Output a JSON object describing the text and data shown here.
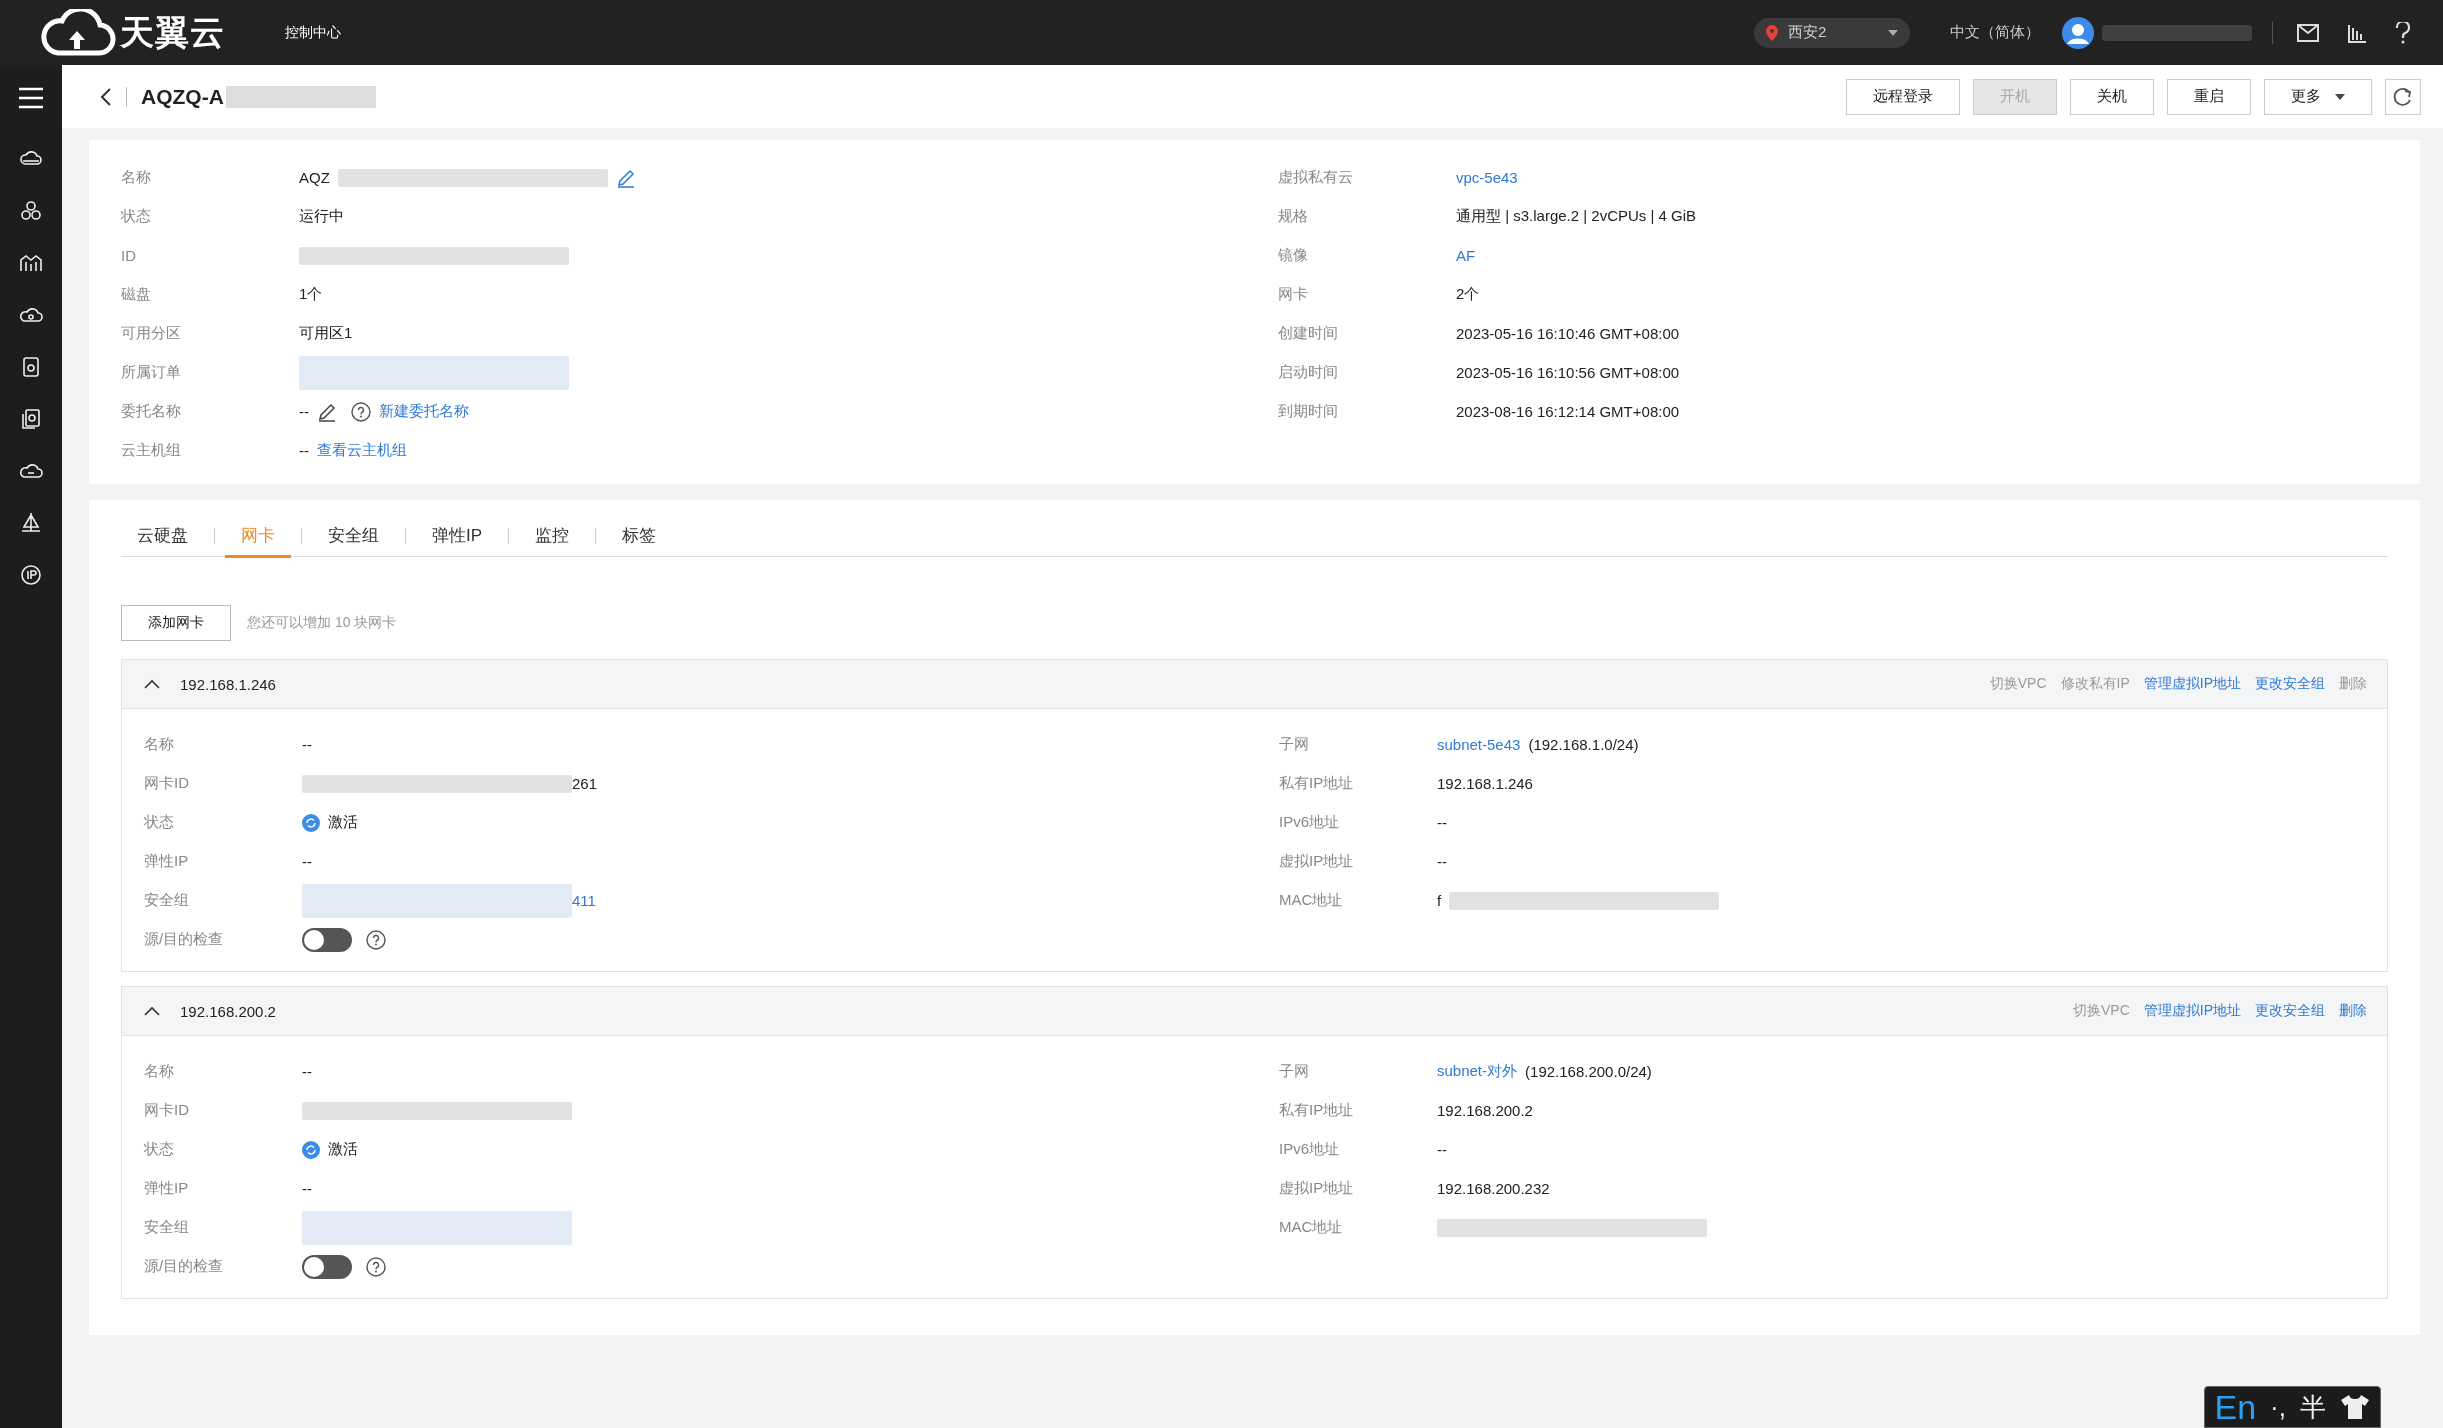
{
  "topbar": {
    "logo": "天翼云",
    "console": "控制中心",
    "region": "西安2",
    "language": "中文（简体）"
  },
  "header": {
    "title": "AQZQ-A",
    "buttons": [
      {
        "label": "远程登录",
        "disabled": false
      },
      {
        "label": "开机",
        "disabled": true
      },
      {
        "label": "关机",
        "disabled": false
      },
      {
        "label": "重启",
        "disabled": false
      },
      {
        "label": "更多",
        "disabled": false,
        "kind": "dropdown"
      }
    ]
  },
  "details": {
    "left": [
      {
        "label": "名称",
        "kind": "editable",
        "value": "AQZ"
      },
      {
        "label": "状态",
        "kind": "text",
        "value": "运行中"
      },
      {
        "label": "ID",
        "kind": "redacted"
      },
      {
        "label": "磁盘",
        "kind": "text",
        "value": "1个"
      },
      {
        "label": "可用分区",
        "kind": "text",
        "value": "可用区1"
      },
      {
        "label": "所属订单",
        "kind": "redacted",
        "is_link": true
      },
      {
        "label": "委托名称",
        "kind": "delegate",
        "value": "--",
        "link": "新建委托名称"
      },
      {
        "label": "云主机组",
        "kind": "value-link",
        "value": "--",
        "link": "查看云主机组"
      }
    ],
    "right": [
      {
        "label": "虚拟私有云",
        "kind": "link",
        "value": "vpc-5e43"
      },
      {
        "label": "规格",
        "kind": "text",
        "value": "通用型 | s3.large.2 | 2vCPUs | 4 GiB"
      },
      {
        "label": "镜像",
        "kind": "link",
        "value": "AF"
      },
      {
        "label": "网卡",
        "kind": "text",
        "value": "2个"
      },
      {
        "label": "创建时间",
        "kind": "text",
        "value": "2023-05-16 16:10:46 GMT+08:00"
      },
      {
        "label": "启动时间",
        "kind": "text",
        "value": "2023-05-16 16:10:56 GMT+08:00"
      },
      {
        "label": "到期时间",
        "kind": "text",
        "value": "2023-08-16 16:12:14 GMT+08:00"
      }
    ]
  },
  "tabs": [
    {
      "label": "云硬盘",
      "selected": false
    },
    {
      "label": "网卡",
      "selected": true
    },
    {
      "label": "安全组",
      "selected": false
    },
    {
      "label": "弹性IP",
      "selected": false
    },
    {
      "label": "监控",
      "selected": false
    },
    {
      "label": "标签",
      "selected": false
    }
  ],
  "add_button": "添加网卡",
  "add_hint": "您还可以增加 10 块网卡",
  "nics": [
    {
      "ip": "192.168.1.246",
      "expanded": true,
      "actions": [
        {
          "label": "切换VPC",
          "disabled": true
        },
        {
          "label": "修改私有IP",
          "disabled": true
        },
        {
          "label": "管理虚拟IP地址",
          "disabled": false
        },
        {
          "label": "更改安全组",
          "disabled": false
        },
        {
          "label": "删除",
          "disabled": true
        }
      ],
      "left": [
        {
          "label": "名称",
          "kind": "text",
          "value": "--"
        },
        {
          "label": "网卡ID",
          "kind": "redacted",
          "suffix": "261"
        },
        {
          "label": "状态",
          "kind": "status",
          "value": "激活"
        },
        {
          "label": "弹性IP",
          "kind": "text",
          "value": "--"
        },
        {
          "label": "安全组",
          "kind": "redacted",
          "is_link": true,
          "suffix": "411"
        },
        {
          "label": "源/目的检查",
          "kind": "toggle",
          "on": false
        }
      ],
      "right": [
        {
          "label": "子网",
          "kind": "subnet",
          "link": "subnet-5e43",
          "value": "(192.168.1.0/24)"
        },
        {
          "label": "私有IP地址",
          "kind": "text",
          "value": "192.168.1.246"
        },
        {
          "label": "IPv6地址",
          "kind": "text",
          "value": "--"
        },
        {
          "label": "虚拟IP地址",
          "kind": "text",
          "value": "--"
        },
        {
          "label": "MAC地址",
          "kind": "redacted",
          "prefix": "f"
        }
      ]
    },
    {
      "ip": "192.168.200.2",
      "expanded": true,
      "actions": [
        {
          "label": "切换VPC",
          "disabled": true
        },
        {
          "label": "管理虚拟IP地址",
          "disabled": false
        },
        {
          "label": "更改安全组",
          "disabled": false
        },
        {
          "label": "删除",
          "disabled": false
        }
      ],
      "left": [
        {
          "label": "名称",
          "kind": "text",
          "value": "--"
        },
        {
          "label": "网卡ID",
          "kind": "redacted"
        },
        {
          "label": "状态",
          "kind": "status",
          "value": "激活"
        },
        {
          "label": "弹性IP",
          "kind": "text",
          "value": "--"
        },
        {
          "label": "安全组",
          "kind": "redacted",
          "is_link": true
        },
        {
          "label": "源/目的检查",
          "kind": "toggle",
          "on": false
        }
      ],
      "right": [
        {
          "label": "子网",
          "kind": "subnet",
          "link": "subnet-对外",
          "value": "(192.168.200.0/24)"
        },
        {
          "label": "私有IP地址",
          "kind": "text",
          "value": "192.168.200.2"
        },
        {
          "label": "IPv6地址",
          "kind": "text",
          "value": "--"
        },
        {
          "label": "虚拟IP地址",
          "kind": "text",
          "value": "192.168.200.232"
        },
        {
          "label": "MAC地址",
          "kind": "redacted"
        }
      ]
    }
  ],
  "ime": {
    "mode": "En",
    "punct": "·,",
    "width": "半"
  }
}
